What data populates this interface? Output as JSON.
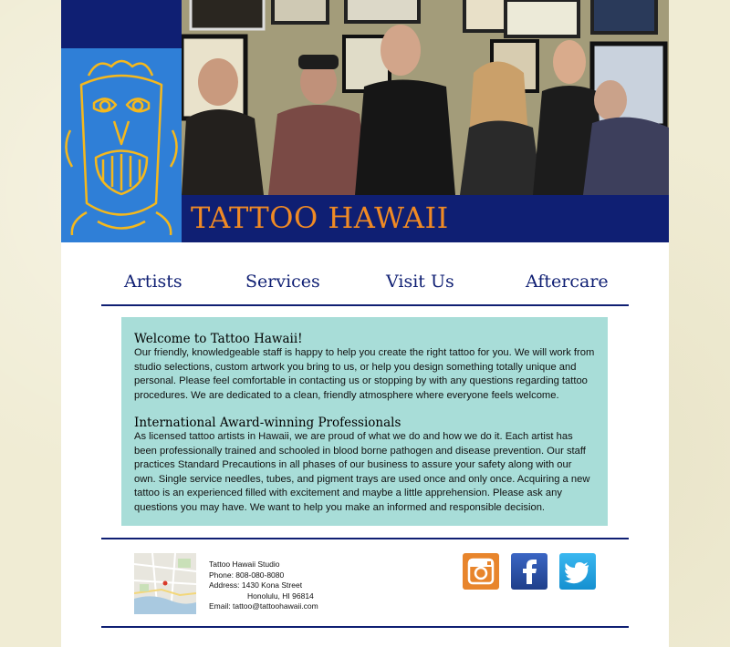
{
  "header": {
    "title": "TATTOO HAWAII",
    "logo_icon": "tiki-mask-icon",
    "photo": "group-photo-artists"
  },
  "nav": {
    "items": [
      "Artists",
      "Services",
      "Visit Us",
      "Aftercare"
    ]
  },
  "content": {
    "welcome_heading": "Welcome to Tattoo Hawaii!",
    "welcome_text": "Our friendly, knowledgeable staff is happy to help you create the right tattoo for you. We will work from studio selections, custom artwork you bring to us, or help you design something totally unique and personal. Please feel comfortable in contacting us or stopping by with any questions regarding tattoo procedures. We are dedicated to a clean, friendly atmosphere where everyone feels welcome.",
    "award_heading": "International Award-winning Professionals",
    "award_text": "As licensed tattoo artists in Hawaii, we are proud of what we do and how we do it. Each artist has been professionally trained and schooled in blood borne pathogen and disease prevention. Our staff practices Standard Precautions in all phases of our business to assure your safety along with our own. Single service needles, tubes, and pigment trays are used once and only once. Acquiring a new tattoo is an experienced filled with excitement and maybe a little apprehension. Please ask any questions you may have. We want to help you make an informed and responsible decision."
  },
  "footer": {
    "studio": "Tattoo Hawaii Studio",
    "phone": "Phone: 808-080-8080",
    "address1": "Address: 1430 Kona Street",
    "address2": "Honolulu, HI 96814",
    "email": "Email: tattoo@tattoohawaii.com",
    "social": [
      "instagram-icon",
      "facebook-icon",
      "twitter-icon"
    ]
  },
  "colors": {
    "navy": "#0f1f73",
    "orange": "#f08a24",
    "blue": "#2f7fd7",
    "teal": "#a8ddd8"
  }
}
